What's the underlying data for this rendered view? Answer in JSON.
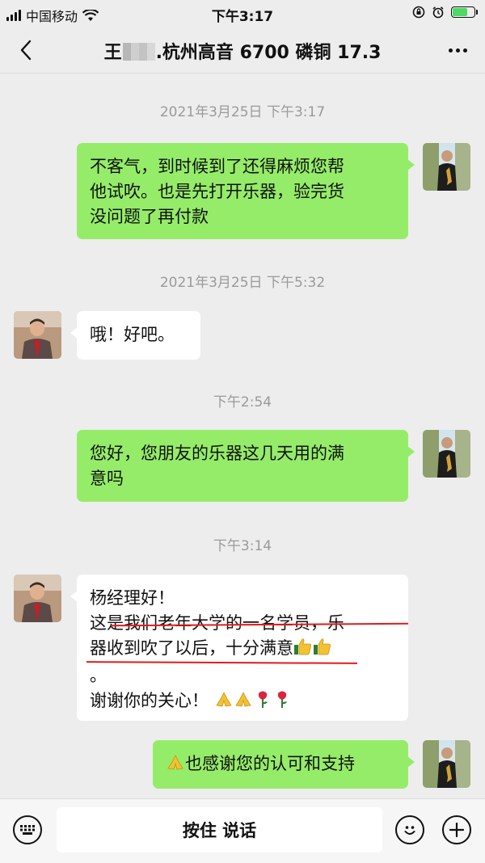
{
  "status_bar": {
    "carrier": "中国移动",
    "time": "下午3:17",
    "battery_level": 0.75
  },
  "nav": {
    "title_prefix": "王",
    "title_suffix": ".杭州高音 6700 磷铜 17.3",
    "back_icon": "chevron-left-icon",
    "more_icon": "ellipsis-icon"
  },
  "messages": {
    "ts1": "2021年3月25日 下午3:17",
    "m1": [
      "不客气，到时候到了还得麻烦您帮",
      "他试吹。也是先打开乐器，验完货",
      "没问题了再付款"
    ],
    "ts2": "2021年3月25日 下午5:32",
    "m2": "哦！好吧。",
    "ts3": "下午2:54",
    "m3": [
      "您好，您朋友的乐器这几天用的满",
      "意吗"
    ],
    "ts4": "下午3:14",
    "m4": {
      "line1": "杨经理好！",
      "line2": "这是我们老年大学的一名学员，乐",
      "line3": "器收到吹了以后，十分满意",
      "line4": "。",
      "line5": "谢谢你的关心！"
    },
    "m5": "也感谢您的认可和支持"
  },
  "input_bar": {
    "hold_to_talk": "按住 说话",
    "keyboard_icon": "keyboard-icon",
    "emoji_icon": "smiley-icon",
    "plus_icon": "plus-icon"
  },
  "colors": {
    "outgoing_bubble": "#95ec69",
    "incoming_bubble": "#ffffff",
    "background": "#ededed",
    "timestamp": "#9a9a9a",
    "underline": "#e21b1b"
  }
}
